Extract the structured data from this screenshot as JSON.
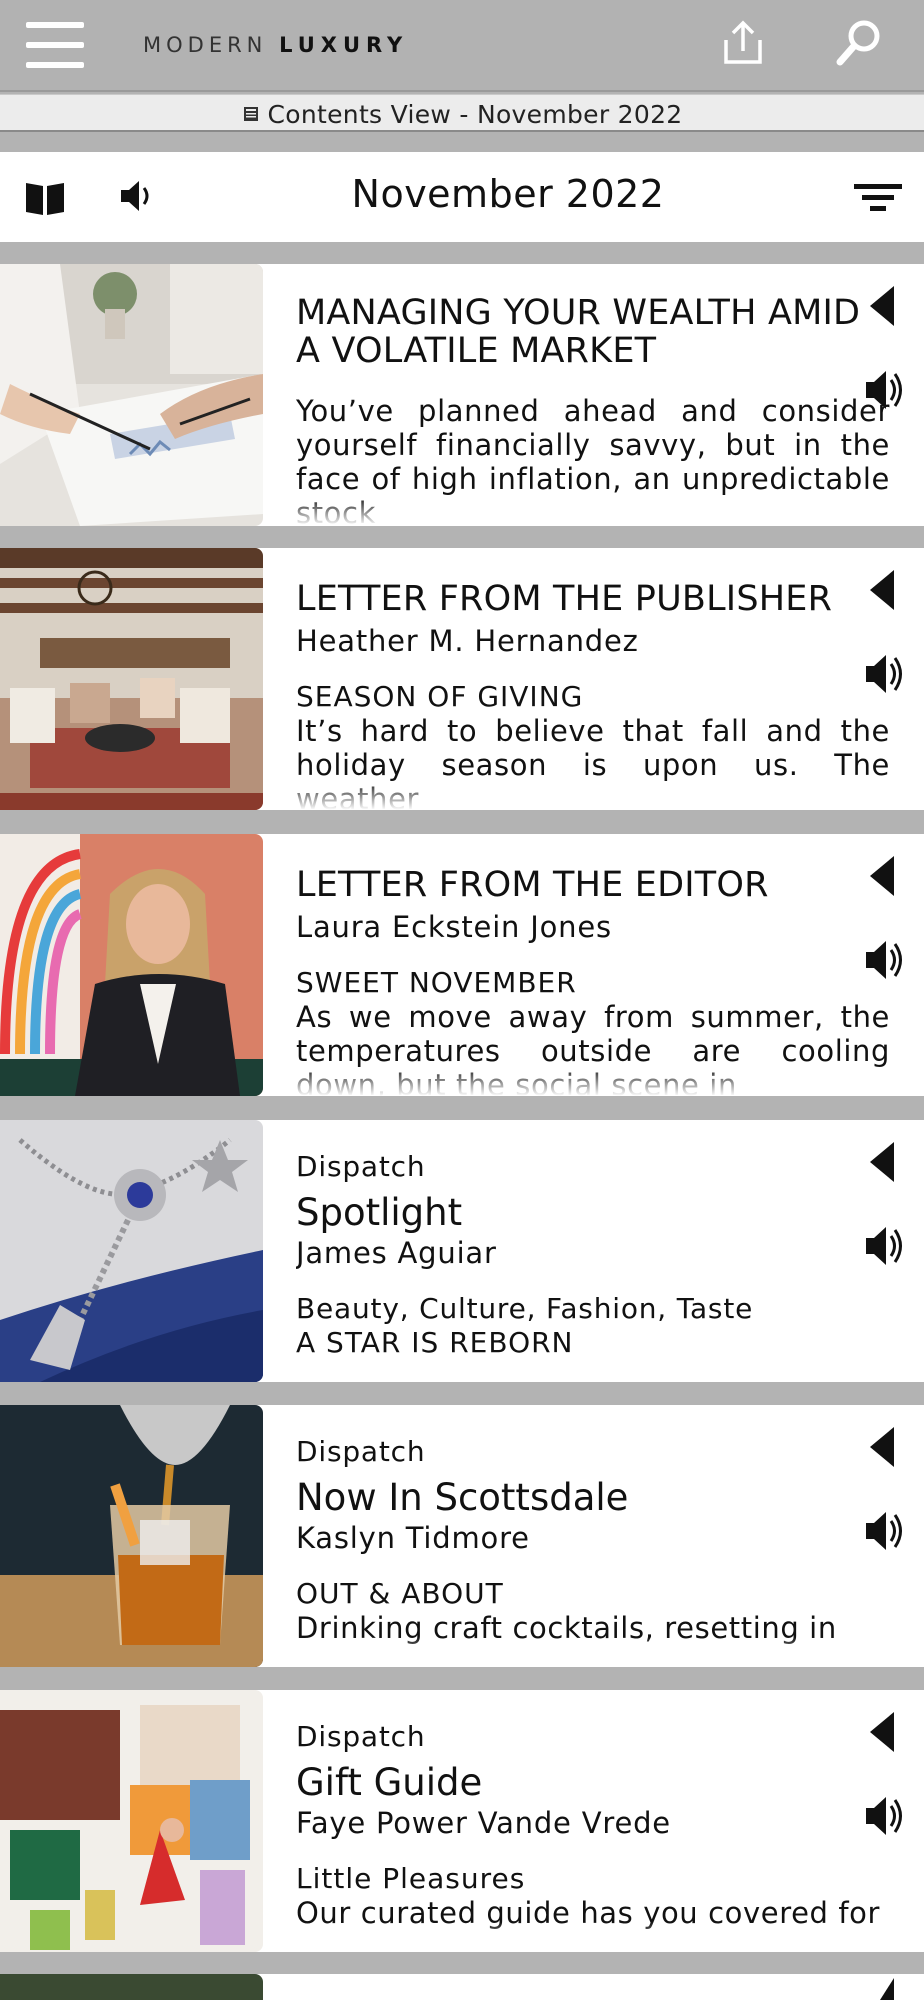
{
  "header": {
    "logo_word1": "MODERN",
    "logo_word2": "LUXURY"
  },
  "contents_bar": {
    "text": "Contents View - November 2022"
  },
  "issue": {
    "title": "November 2022"
  },
  "articles": [
    {
      "title": "MANAGING YOUR WEALTH AMID A VOLATILE MARKET",
      "body": "You’ve planned ahead and consider yourself financially savvy, but in the face of high inflation, an unpredictable stock"
    },
    {
      "title": "LETTER FROM THE PUBLISHER",
      "author": "Heather M. Hernandez",
      "section": "SEASON OF GIVING",
      "body": "It’s hard to believe that fall and the holiday season is upon us. The weather"
    },
    {
      "title": "LETTER FROM THE EDITOR",
      "author": "Laura Eckstein Jones",
      "section": "SWEET NOVEMBER",
      "body": "As we move away from summer, the temperatures outside are cooling down, but the social scene in"
    },
    {
      "category": "Dispatch",
      "title": "Spotlight",
      "author": "James Aguiar",
      "tags": "Beauty, Culture, Fashion, Taste",
      "section": "A STAR IS REBORN"
    },
    {
      "category": "Dispatch",
      "title": "Now In Scottsdale",
      "author": "Kaslyn Tidmore",
      "section": "OUT & ABOUT",
      "body": "Drinking craft cocktails, resetting in"
    },
    {
      "category": "Dispatch",
      "title": "Gift Guide",
      "author": "Faye Power Vande Vrede",
      "section": "Little Pleasures",
      "body": "Our curated guide has you covered for"
    }
  ],
  "icons": {
    "menu": "hamburger-menu-icon",
    "share": "share-icon",
    "search": "search-icon",
    "book": "book-icon",
    "audio": "speaker-icon",
    "filter": "filter-icon",
    "back": "back-triangle-icon"
  }
}
